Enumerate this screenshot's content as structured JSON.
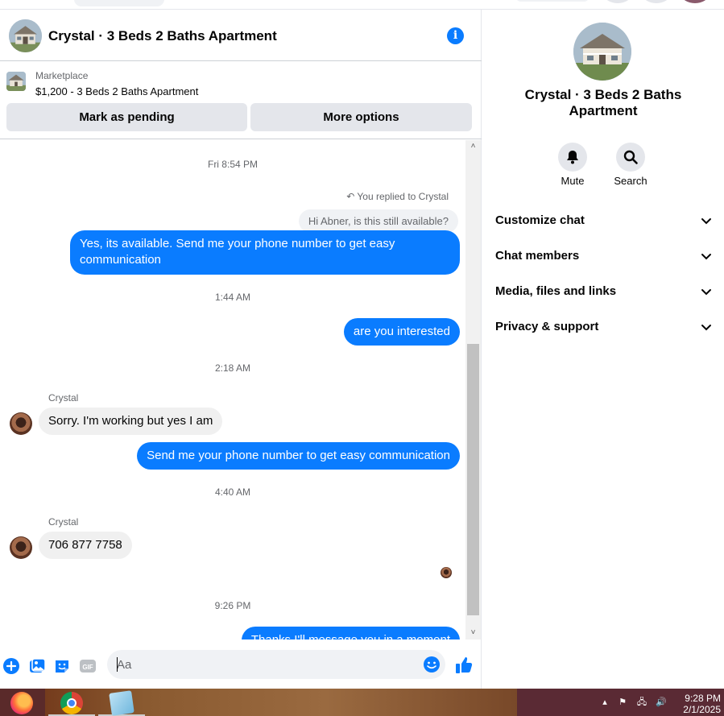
{
  "header": {
    "title": "Crystal · 3 Beds 2 Baths Apartment",
    "info_icon": "info-icon"
  },
  "marketplace": {
    "label": "Marketplace",
    "item": "$1,200 - 3 Beds 2 Baths Apartment",
    "mark_pending_label": "Mark as pending",
    "more_options_label": "More options"
  },
  "thread": {
    "ts1": "Fri 8:54 PM",
    "replied_note": "You replied to Crystal",
    "quoted": "Hi Abner, is this still available?",
    "msg1": "Yes, its available. Send me your phone number to get easy",
    "msg1b": "communication",
    "ts2": "1:44 AM",
    "msg2": "are you interested",
    "ts3": "2:18 AM",
    "sender1": "Crystal",
    "msg3": "Sorry. I'm working but yes I am",
    "msg4": "Send me your phone number to get easy communication",
    "ts4": "4:40 AM",
    "sender2": "Crystal",
    "msg5": "706 877 7758",
    "ts5": "9:26 PM",
    "msg6": "Thanks I'll message you in a moment"
  },
  "composer": {
    "placeholder": "Aa",
    "icons": [
      "plus-icon",
      "photo-icon",
      "sticker-icon",
      "gif-icon",
      "emoji-icon",
      "like-icon"
    ],
    "gif_label": "GIF"
  },
  "sidebar": {
    "title": "Crystal · 3 Beds 2 Baths Apartment",
    "mute_label": "Mute",
    "search_label": "Search",
    "sections": [
      "Customize chat",
      "Chat members",
      "Media, files and links",
      "Privacy & support"
    ]
  },
  "taskbar": {
    "time": "9:28 PM",
    "date": "2/1/2025"
  },
  "colors": {
    "accent": "#0a7cff",
    "bubble_them": "#f0f0f0",
    "button_bg": "#e4e6eb"
  }
}
